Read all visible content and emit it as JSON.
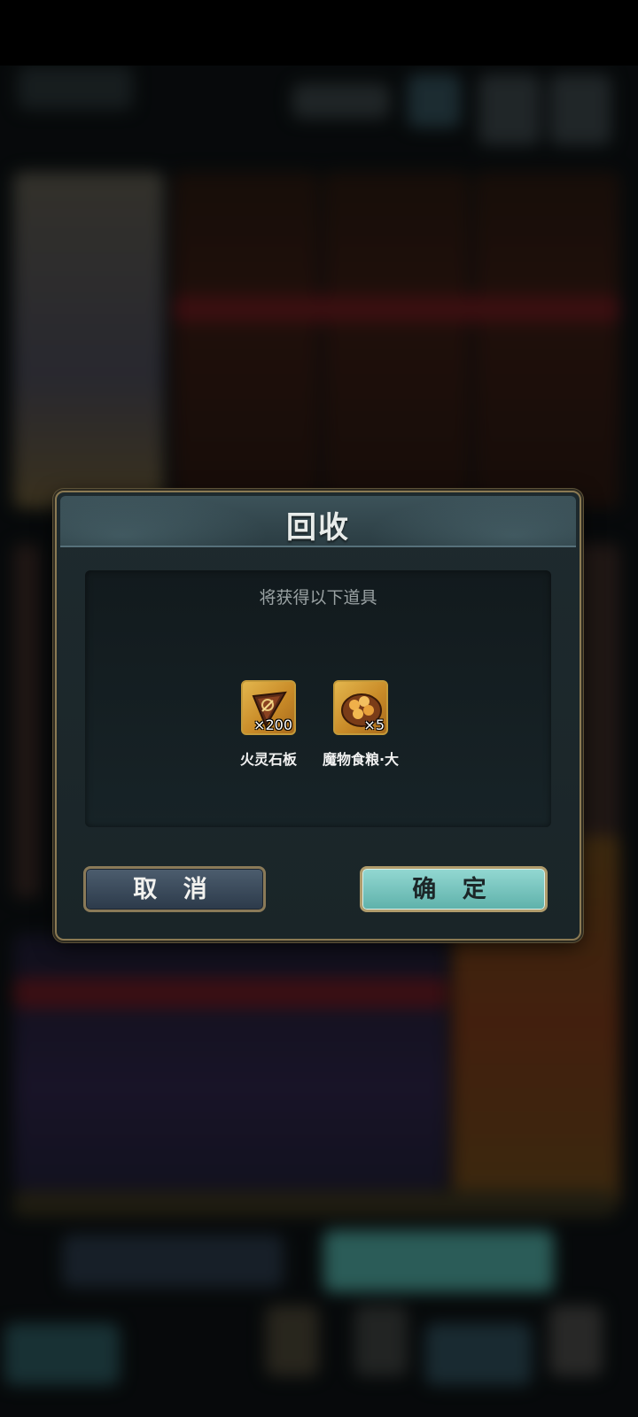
{
  "dialog": {
    "title": "回收",
    "subtitle": "将获得以下道具",
    "rewards": [
      {
        "name": "火灵石板",
        "quantity": "×200",
        "icon": "fire-spirit-slate-icon"
      },
      {
        "name": "魔物食粮·大",
        "quantity": "×5",
        "icon": "monster-food-large-icon"
      }
    ],
    "cancel_label": "取 消",
    "confirm_label": "确 定"
  },
  "colors": {
    "confirm_button": "#6cc3bc",
    "cancel_button": "#3a4a5b",
    "frame_gold": "#8b7a53"
  }
}
